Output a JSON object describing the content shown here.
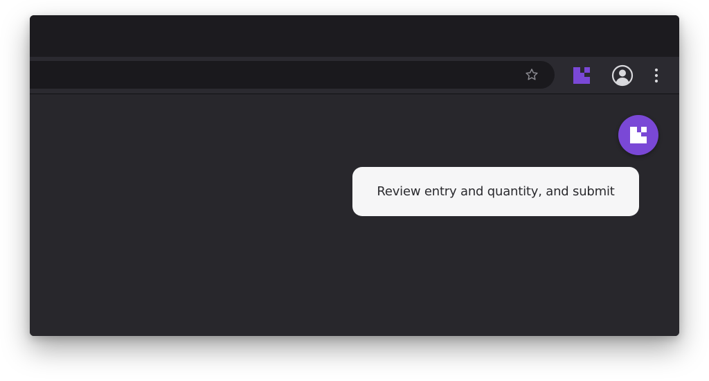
{
  "browser": {
    "toolbar": {
      "icons": {
        "bookmark": "star-icon",
        "extension": "extension-logo-icon",
        "profile": "account-circle-icon",
        "menu": "kebab-menu-icon"
      }
    }
  },
  "overlay": {
    "assistant_button_icon": "assistant-logo-icon",
    "tooltip_text": "Review entry and quantity, and submit"
  },
  "colors": {
    "accent": "#7a48d6",
    "window_bg": "#28272c",
    "titlebar_bg": "#1c1b1f",
    "toolbar_bg": "#2b2a30",
    "tooltip_bg": "#f6f6f7",
    "tooltip_text": "#2a2a2e"
  }
}
